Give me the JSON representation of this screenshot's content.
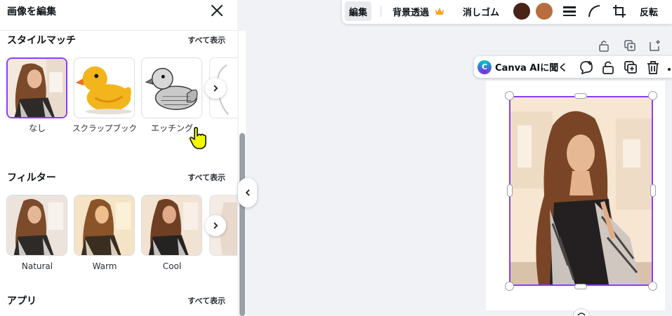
{
  "panel": {
    "title": "画像を編集",
    "sections": {
      "style_match": {
        "title": "スタイルマッチ",
        "see_all": "すべて表示"
      },
      "filters": {
        "title": "フィルター",
        "see_all": "すべて表示"
      },
      "apps": {
        "title": "アプリ",
        "see_all": "すべて表示"
      }
    },
    "styles": [
      {
        "label": "なし",
        "selected": true
      },
      {
        "label": "スクラップブック"
      },
      {
        "label": "エッチング"
      }
    ],
    "filters": [
      {
        "label": "Natural"
      },
      {
        "label": "Warm"
      },
      {
        "label": "Cool"
      }
    ]
  },
  "toolbar": {
    "edit": "編集",
    "bg_remove": "背景透過",
    "eraser": "消しゴム",
    "flip": "反転",
    "colors": {
      "swatch1": "#4a2318",
      "swatch2": "#b86d3f",
      "accent": "#8b3dff",
      "crown": "#f5a623"
    }
  },
  "ai_bar": {
    "label": "Canva AIに聞く"
  }
}
